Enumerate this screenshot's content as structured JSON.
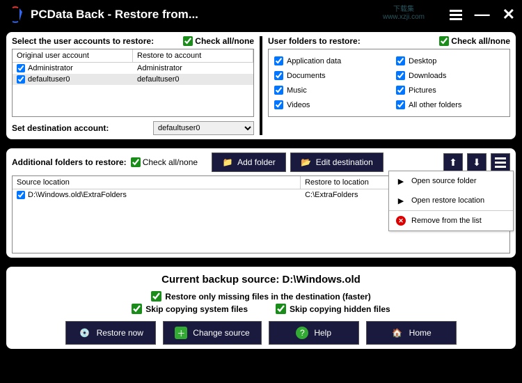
{
  "window": {
    "title": "PCData Back - Restore from..."
  },
  "watermark": {
    "line1": "下载集",
    "line2": "www.xzji.com"
  },
  "accounts_section": {
    "label": "Select the user accounts to restore:",
    "check_all_label": "Check all/none",
    "cols": {
      "c1": "Original user account",
      "c2": "Restore to account"
    },
    "rows": [
      {
        "checked": true,
        "orig": "Administrator",
        "restore": "Administrator",
        "hl": false
      },
      {
        "checked": true,
        "orig": "defaultuser0",
        "restore": "defaultuser0",
        "hl": true
      }
    ],
    "dest_label": "Set destination account:",
    "dest_selected": "defaultuser0"
  },
  "user_folders_section": {
    "label": "User folders to restore:",
    "check_all_label": "Check all/none",
    "items": [
      {
        "label": "Application data",
        "checked": true
      },
      {
        "label": "Desktop",
        "checked": true
      },
      {
        "label": "Documents",
        "checked": true
      },
      {
        "label": "Downloads",
        "checked": true
      },
      {
        "label": "Music",
        "checked": true
      },
      {
        "label": "Pictures",
        "checked": true
      },
      {
        "label": "Videos",
        "checked": true
      },
      {
        "label": "All other folders",
        "checked": true
      }
    ]
  },
  "additional_section": {
    "label": "Additional folders to restore:",
    "check_all_label": "Check all/none",
    "add_folder_btn": "Add folder",
    "edit_dest_btn": "Edit destination",
    "cols": {
      "c1": "Source location",
      "c2": "Restore to location"
    },
    "rows": [
      {
        "checked": true,
        "src": "D:\\Windows.old\\ExtraFolders",
        "dst": "C:\\ExtraFolders"
      }
    ]
  },
  "context_menu": {
    "open_source": "Open source folder",
    "open_restore": "Open restore location",
    "remove": "Remove from the list"
  },
  "bottom": {
    "backup_source_label": "Current backup source: ",
    "backup_source_value": "D:\\Windows.old",
    "opt_missing": "Restore only missing files in the destination (faster)",
    "opt_skip_system": "Skip copying system files",
    "opt_skip_hidden": "Skip copying hidden files",
    "restore_btn": "Restore now",
    "change_btn": "Change source",
    "help_btn": "Help",
    "home_btn": "Home"
  }
}
